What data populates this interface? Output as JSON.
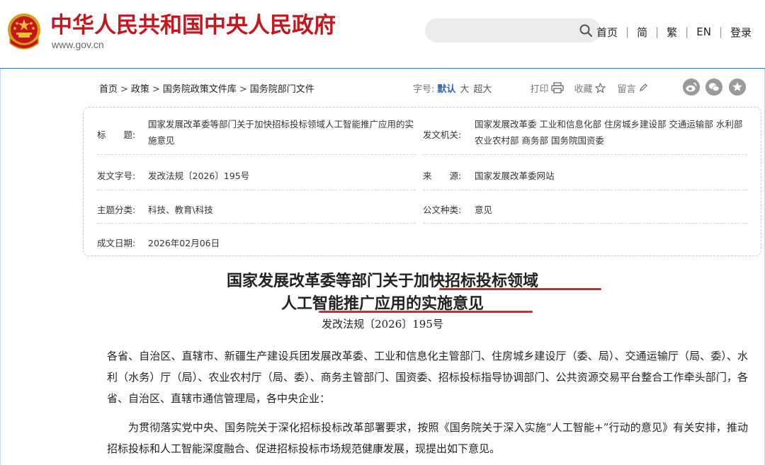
{
  "header": {
    "site_title": "中华人民共和国中央人民政府",
    "site_url": "www.gov.cn",
    "search": {
      "placeholder": ""
    },
    "nav": [
      "首页",
      "简",
      "繁",
      "EN",
      "登录"
    ]
  },
  "breadcrumb": [
    "首页",
    "政策",
    "国务院政策文件库",
    "国务院部门文件"
  ],
  "toolbar": {
    "font_size_label": "字号:",
    "font_size_options": [
      "默认",
      "大",
      "超大"
    ],
    "print_label": "打印",
    "favorite_label": "收藏",
    "comment_label": "留言"
  },
  "share": {
    "icons": [
      "weibo-icon",
      "wechat-icon",
      "favorite-star-icon"
    ]
  },
  "info": {
    "title_label": "标　　题:",
    "title_value": "国家发展改革委等部门关于加快招标投标领域人工智能推广应用的实施意见",
    "issuer_label": "发文机关:",
    "issuer_value": "国家发展改革委 工业和信息化部 住房城乡建设部 交通运输部 水利部 农业农村部 商务部 国务院国资委",
    "doc_no_label": "发文字号:",
    "doc_no_value": "发改法规〔2026〕195号",
    "source_label": "来　　源:",
    "source_value": "国家发展改革委网站",
    "topic_label": "主题分类:",
    "topic_value": "科技、教育\\科技",
    "type_label": "公文种类:",
    "type_value": "意见",
    "date_label": "成文日期:",
    "date_value": "2026年02月06日"
  },
  "document": {
    "title_line1": "国家发展改革委等部门关于加快招标投标领域",
    "title_line2": "人工智能推广应用的实施意见",
    "number": "发改法规〔2026〕195号",
    "paragraph1": "各省、自治区、直辖市、新疆生产建设兵团发展改革委、工业和信息化主管部门、住房城乡建设厅（委、局）、交通运输厅（局、委）、水利（水务）厅（局）、农业农村厅（局、委）、商务主管部门、国资委、招标投标指导协调部门、公共资源交易平台整合工作牵头部门，各省、自治区、直辖市通信管理局，各中央企业：",
    "paragraph2": "为贯彻落实党中央、国务院关于深化招标投标改革部署要求，按照《国务院关于深入实施“人工智能+”行动的意见》有关安排，推动招标投标和人工智能深度融合、促进招标投标市场规范健康发展，现提出如下意见。"
  },
  "colors": {
    "brand_red": "#c4161c",
    "header_border": "#2f74c0",
    "accent_blue": "#2a66b5",
    "highlight_underline": "#d8262d"
  }
}
